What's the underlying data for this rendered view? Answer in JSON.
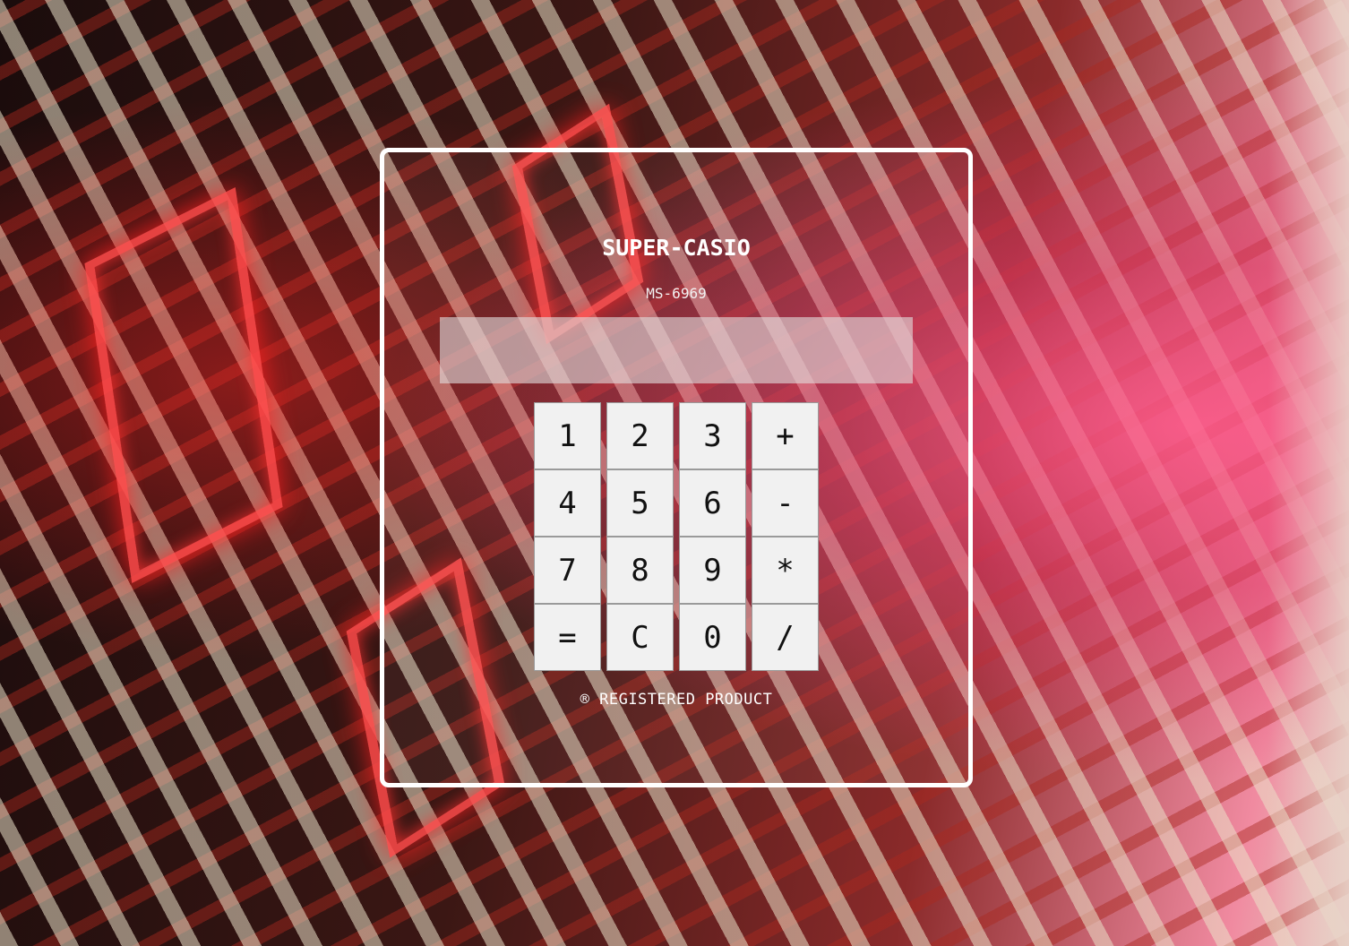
{
  "calculator": {
    "brand": "SUPER-CASIO",
    "model": "MS-6969",
    "display_value": "",
    "keys": [
      "1",
      "2",
      "3",
      "+",
      "4",
      "5",
      "6",
      "-",
      "7",
      "8",
      "9",
      "*",
      "=",
      "C",
      "0",
      "/"
    ],
    "footer": "® REGISTERED PRODUCT"
  },
  "colors": {
    "card_border": "#ffffff",
    "key_background": "#f1f1f1",
    "display_background": "#e1dcdc",
    "led_red": "#ff4a4a"
  }
}
